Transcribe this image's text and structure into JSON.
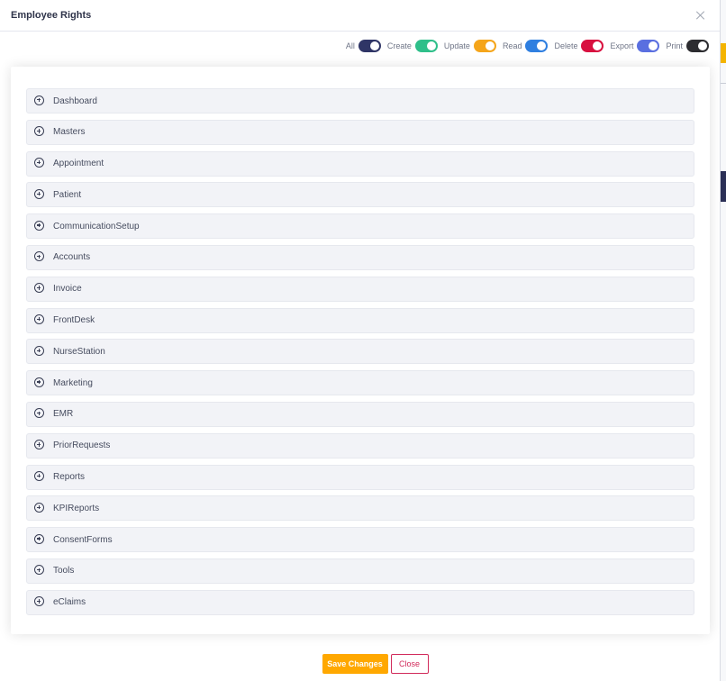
{
  "modal": {
    "title": "Employee Rights"
  },
  "permissions": [
    {
      "label": "All",
      "color": "#2f3566"
    },
    {
      "label": "Create",
      "color": "#2fbf8a"
    },
    {
      "label": "Update",
      "color": "#f5a51a"
    },
    {
      "label": "Read",
      "color": "#2f7fe0"
    },
    {
      "label": "Delete",
      "color": "#d8103f"
    },
    {
      "label": "Export",
      "color": "#5a6fe0"
    },
    {
      "label": "Print",
      "color": "#2c2c30"
    }
  ],
  "modules": [
    "Dashboard",
    "Masters",
    "Appointment",
    "Patient",
    "CommunicationSetup",
    "Accounts",
    "Invoice",
    "FrontDesk",
    "NurseStation",
    "Marketing",
    "EMR",
    "PriorRequests",
    "Reports",
    "KPIReports",
    "ConsentForms",
    "Tools",
    "eClaims"
  ],
  "footer": {
    "save_label": "Save Changes",
    "close_label": "Close"
  }
}
